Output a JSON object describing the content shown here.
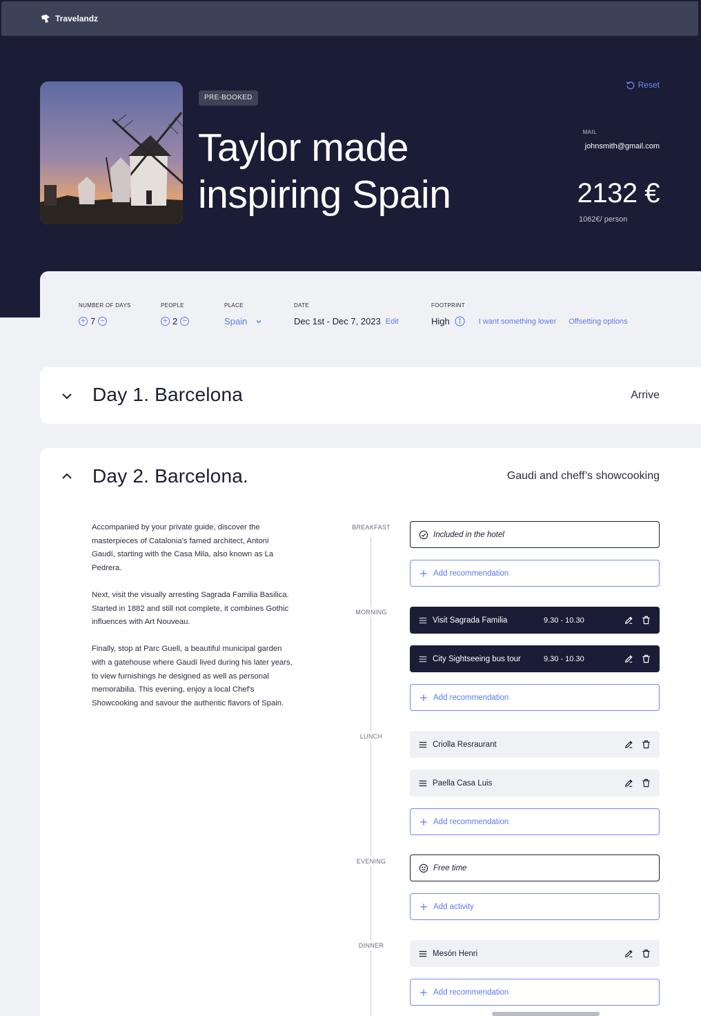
{
  "app": {
    "brand": "Travelandz"
  },
  "hero": {
    "badge": "PRE-BOOKED",
    "title": "Taylor made inspiring Spain",
    "reset_label": "Reset",
    "mail_label": "MAIL",
    "mail_value": "johnsmith@gmail.com",
    "price": "2132 €",
    "per_person": "1062€/ person"
  },
  "filters": {
    "days": {
      "label": "NUMBER OF DAYS",
      "value": "7"
    },
    "people": {
      "label": "PEOPLE",
      "value": "2"
    },
    "place": {
      "label": "PLACE",
      "value": "Spain"
    },
    "date": {
      "label": "DATE",
      "value": "Dec 1st - Dec 7, 2023",
      "edit": "Edit"
    },
    "footprint": {
      "label": "FOOTPRINT",
      "value": "High",
      "lower_link": "I want something lower",
      "offset_link": "Offsetting options"
    }
  },
  "days": [
    {
      "title": "Day 1. Barcelona",
      "subtitle": "Arrive",
      "expanded": false
    },
    {
      "title": "Day 2. Barcelona.",
      "subtitle": "Gaudi and cheff’s showcooking",
      "expanded": true,
      "description": [
        "Accompanied by your private guide, discover the masterpieces of Catalonia's famed architect, Antoni Gaudí, starting with the Casa Mila, also known as La Pedrera.",
        "Next, visit the visually arresting Sagrada Familia Basilica. Started in 1882 and still not complete, it combines Gothic influences with Art Nouveau.",
        "Finally, stop at Parc Guell, a beautiful municipal garden with a gatehouse where Gaudí lived during his later years, to view furnishings he designed as well as personal memorabilia. This evening, enjoy a local Chef's Showcooking and savour the authentic flavors of Spain."
      ],
      "slots": {
        "breakfast": {
          "label": "BREAKFAST",
          "included": "Included in the hotel",
          "add": "Add recommendation"
        },
        "morning": {
          "label": "MORNING",
          "items": [
            {
              "name": "Visit Sagrada Familia",
              "time": "9.30 - 10.30"
            },
            {
              "name": "City Sightseeing bus tour",
              "time": "9.30 - 10.30"
            }
          ],
          "add": "Add recommendation"
        },
        "lunch": {
          "label": "LUNCH",
          "items": [
            {
              "name": "Criolla Resraurant"
            },
            {
              "name": "Paella Casa Luis"
            }
          ],
          "add": "Add recommendation"
        },
        "evening": {
          "label": "EVENING",
          "free": "Free time",
          "add": "Add activity"
        },
        "dinner": {
          "label": "DINNER",
          "items": [
            {
              "name": "Mesón Henri"
            }
          ],
          "add": "Add recommendation"
        }
      }
    }
  ],
  "colors": {
    "navy": "#1b1c35",
    "accent": "#5b7be8",
    "panel": "#f0f1f5"
  }
}
